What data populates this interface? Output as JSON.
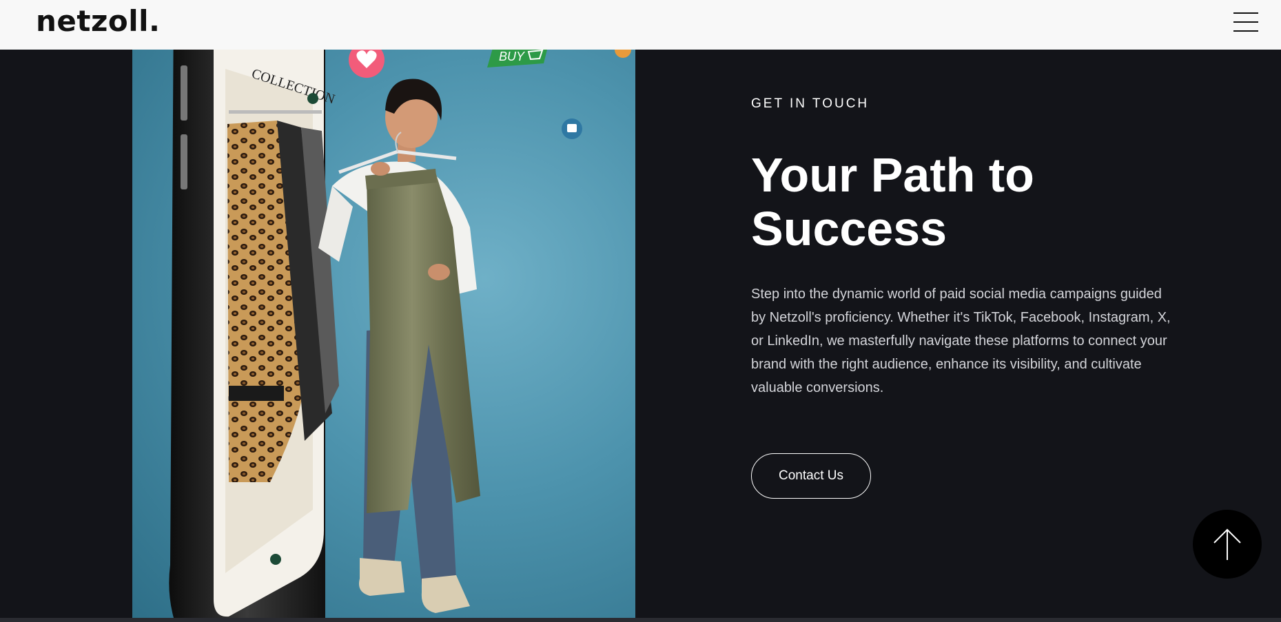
{
  "header": {
    "logo": "netzoll.",
    "menu_icon": "hamburger-menu-icon"
  },
  "hero": {
    "image_description": "Smartphone with collection screen and woman holding trousers",
    "screen_label": "COLLECTION",
    "sticker_label": "BUY",
    "icons": [
      "heart-icon",
      "cart-icon",
      "chat-icon"
    ]
  },
  "content": {
    "eyebrow": "GET IN TOUCH",
    "title": "Your Path to Success",
    "body": "Step into the dynamic world of paid social media campaigns guided by Netzoll's proficiency. Whether it's TikTok, Facebook, Instagram, X, or LinkedIn, we masterfully navigate these platforms to connect your brand with the right audience, enhance its visibility, and cultivate valuable conversions.",
    "cta_label": "Contact Us"
  },
  "scroll_top": {
    "icon": "arrow-up-icon"
  },
  "colors": {
    "background": "#131419",
    "header": "#f8f8f8",
    "accent_white": "#ffffff",
    "hero_blue": "#4d93ad"
  }
}
